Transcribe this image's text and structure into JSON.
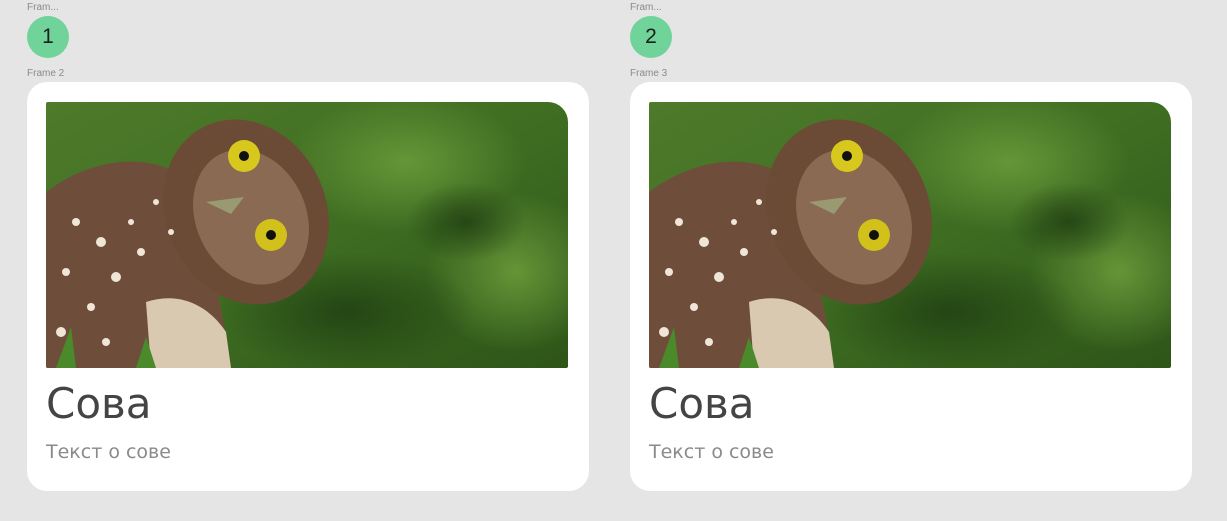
{
  "frames": [
    {
      "top_label": "Fram...",
      "badge": "1",
      "frame_label": "Frame 2",
      "card": {
        "title": "Сова",
        "text": "Текст о сове",
        "image": "owl-photo"
      }
    },
    {
      "top_label": "Fram...",
      "badge": "2",
      "frame_label": "Frame 3",
      "card": {
        "title": "Сова",
        "text": "Текст о сове",
        "image": "owl-photo"
      }
    }
  ],
  "colors": {
    "canvas": "#e5e5e5",
    "card": "#ffffff",
    "badge": "#6fd39a",
    "title": "#444444",
    "text": "#8a8a8a"
  }
}
